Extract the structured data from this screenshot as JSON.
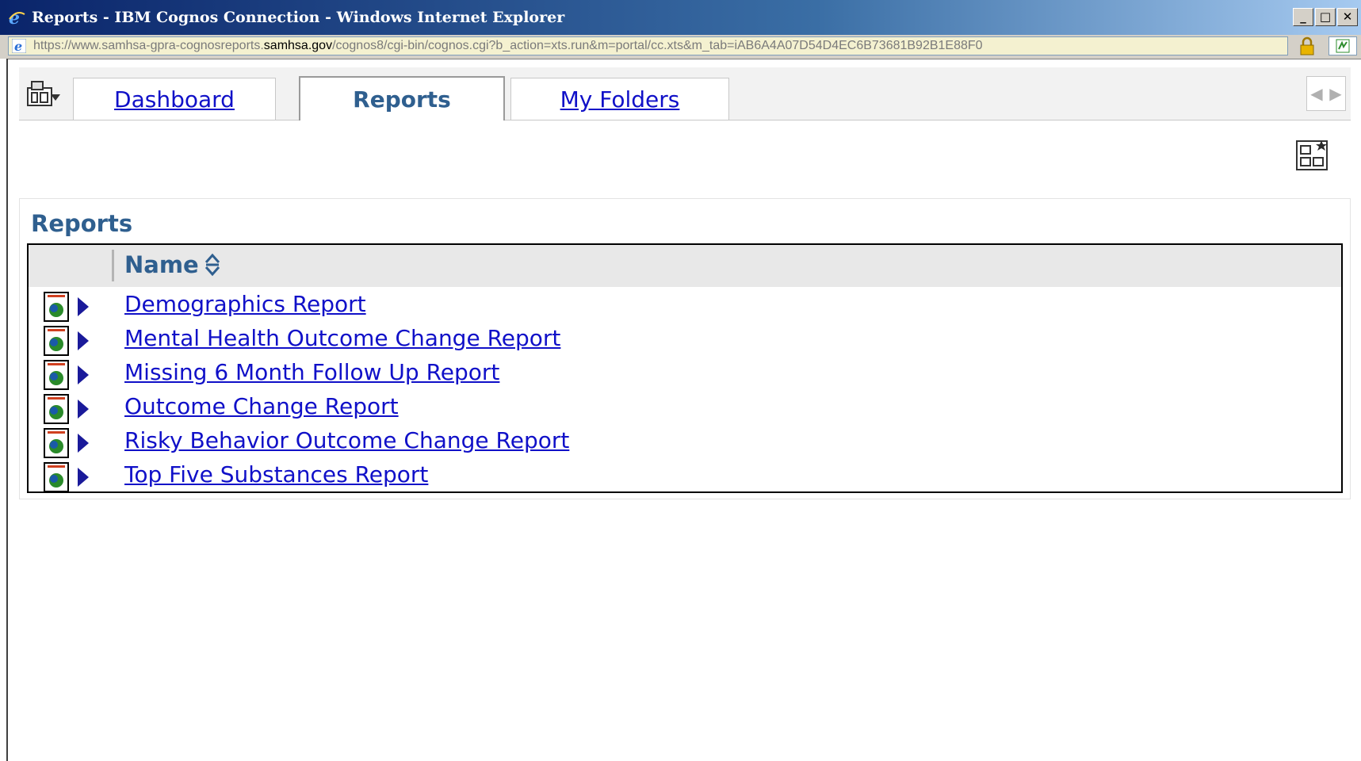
{
  "window": {
    "title": "Reports - IBM Cognos Connection - Windows Internet Explorer",
    "controls": {
      "minimize": "_",
      "maximize": "□",
      "close": "✕"
    }
  },
  "address": {
    "url_prefix": "https://www.samhsa-gpra-cognosreports.",
    "url_domain": "samhsa.gov",
    "url_suffix": "/cognos8/cgi-bin/cognos.cgi?b_action=xts.run&m=portal/cc.xts&m_tab=iAB6A4A07D54D4EC6B73681B92B1E88F0"
  },
  "tabs": [
    {
      "label": "Dashboard",
      "active": false
    },
    {
      "label": "Reports",
      "active": true
    },
    {
      "label": "My Folders",
      "active": false
    }
  ],
  "portlet": {
    "title": "Reports",
    "column_header": "Name"
  },
  "reports": [
    {
      "name": "Demographics Report"
    },
    {
      "name": "Mental Health Outcome Change Report"
    },
    {
      "name": "Missing 6 Month Follow Up Report"
    },
    {
      "name": "Outcome Change Report"
    },
    {
      "name": "Risky Behavior Outcome Change Report"
    },
    {
      "name": "Top Five Substances Report"
    }
  ],
  "icons": {
    "browser": "ie-icon",
    "security": "lock-icon",
    "tools": "portal-tools-icon",
    "layout": "page-layout-icon",
    "sort": "sort-icon",
    "report": "report-icon",
    "action": "run-arrow-icon"
  },
  "colors": {
    "link": "#1010c8",
    "heading": "#2f5f8f",
    "titlebar": "#0a246a"
  }
}
